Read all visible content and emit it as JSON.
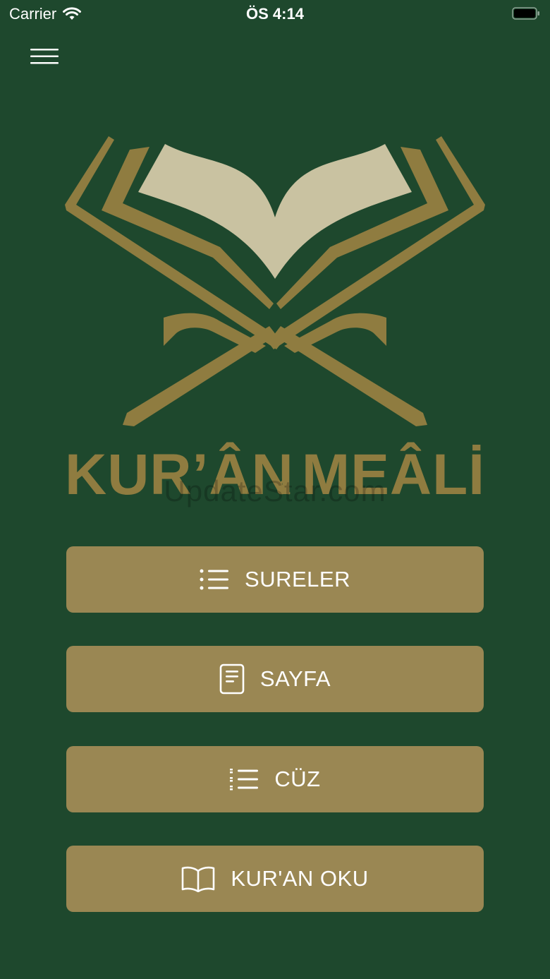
{
  "status_bar": {
    "carrier": "Carrier",
    "time": "ÖS 4:14"
  },
  "logo": {
    "title": "KUR’ÂN MEÂLİ",
    "title_left": "KUR’ÂN",
    "ampersand": "&",
    "title_right": "MEÂLİ"
  },
  "watermark": "UpdateStar.com",
  "menu": {
    "buttons": [
      {
        "label": "SURELER",
        "icon": "list-icon"
      },
      {
        "label": "SAYFA",
        "icon": "document-icon"
      },
      {
        "label": "CÜZ",
        "icon": "list-dashed-icon"
      },
      {
        "label": "KUR'AN OKU",
        "icon": "open-book-icon"
      }
    ]
  },
  "colors": {
    "background": "#1e482d",
    "gold": "#8f7c40",
    "button": "#9a8753",
    "page": "#c9c2a1",
    "text": "#ffffff"
  }
}
